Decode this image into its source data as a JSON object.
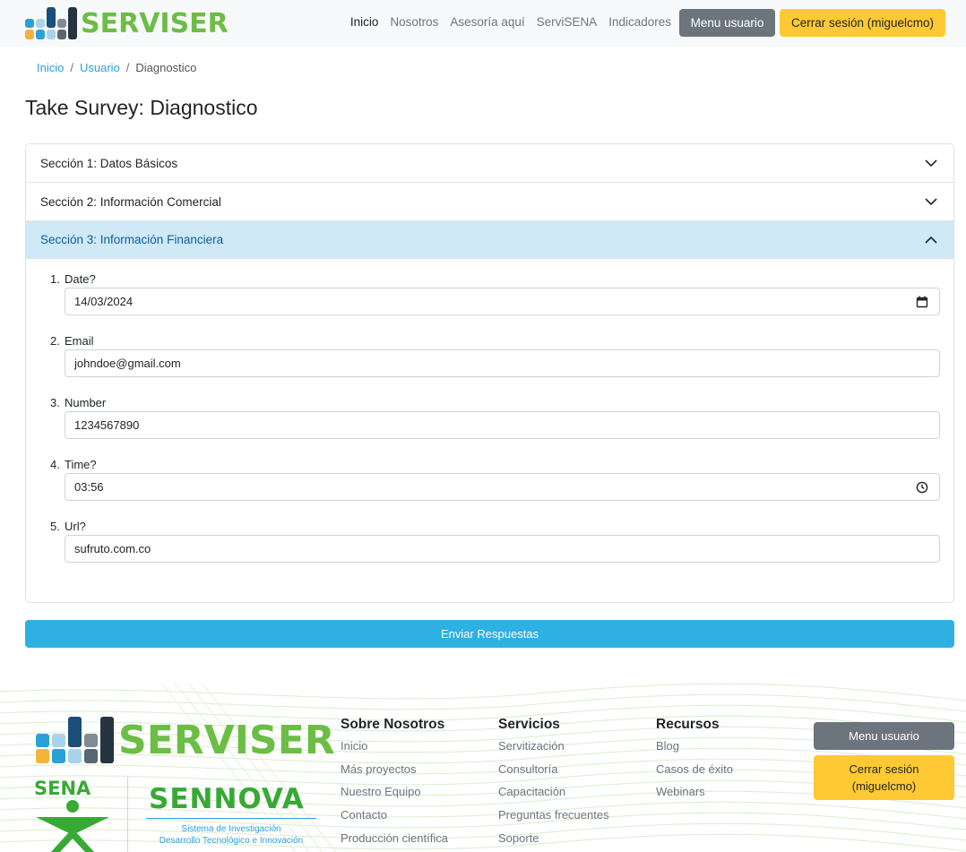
{
  "navbar": {
    "brand": "SERVISER",
    "links": [
      "Inicio",
      "Nosotros",
      "Asesoría aquí",
      "ServiSENA",
      "Indicadores"
    ],
    "menu_button": "Menu usuario",
    "logout_button": "Cerrar sesión (miguelcmo)"
  },
  "breadcrumb": {
    "items": [
      "Inicio",
      "Usuario"
    ],
    "current": "Diagnostico",
    "separator": "/"
  },
  "page_title": "Take Survey: Diagnostico",
  "accordion": {
    "sections": [
      {
        "title": "Sección 1: Datos Básicos",
        "state": "collapsed"
      },
      {
        "title": "Sección 2: Información Comercial",
        "state": "collapsed"
      },
      {
        "title": "Sección 3: Información Financiera",
        "state": "expanded"
      }
    ],
    "questions": [
      {
        "num": "1.",
        "label": "Date?",
        "value": "14/03/2024",
        "icon": "calendar-icon"
      },
      {
        "num": "2.",
        "label": "Email",
        "value": "johndoe@gmail.com"
      },
      {
        "num": "3.",
        "label": "Number",
        "value": "1234567890"
      },
      {
        "num": "4.",
        "label": "Time?",
        "value": "03:56",
        "icon": "clock-icon"
      },
      {
        "num": "5.",
        "label": "Url?",
        "value": "sufruto.com.co"
      }
    ]
  },
  "submit_button": "Enviar Respuestas",
  "footer": {
    "brand": "SERVISER",
    "sena": "SENA",
    "sennova": "SENNOVA",
    "sennova_subtitle_1": "Sistema de Investigación",
    "sennova_subtitle_2": "Desarrollo Tecnológico e Innovación",
    "columns": [
      {
        "title": "Sobre Nosotros",
        "links": [
          "Inicio",
          "Más proyectos",
          "Nuestro Equipo",
          "Contacto",
          "Producción científica"
        ]
      },
      {
        "title": "Servicios",
        "links": [
          "Servitización",
          "Consultoría",
          "Capacitación",
          "Preguntas frecuentes",
          "Soporte"
        ]
      },
      {
        "title": "Recursos",
        "links": [
          "Blog",
          "Casos de éxito",
          "Webinars"
        ]
      }
    ],
    "menu_button": "Menu usuario",
    "logout_button": "Cerrar sesión (miguelcmo)"
  },
  "colors": {
    "brand_green": "#6cbd45",
    "accent_blue": "#2fb0e2",
    "logout_yellow": "#ffc933",
    "secondary_gray": "#6c757d"
  }
}
